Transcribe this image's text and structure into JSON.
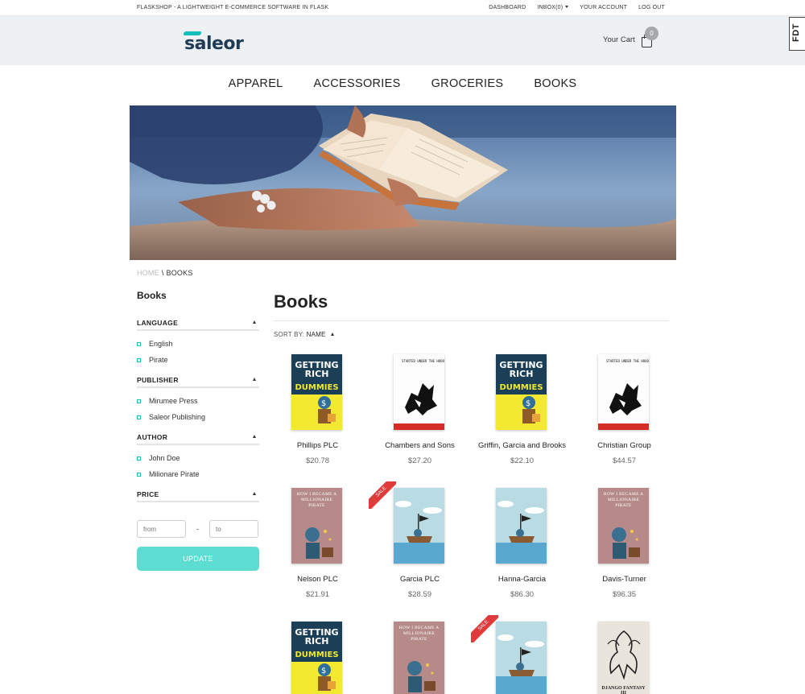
{
  "topbar": {
    "tagline": "FLASKSHOP - A LIGHTWEIGHT E-COMMERCE SOFTWARE IN FLASK",
    "links": [
      "DASHBOARD",
      "INBOX(0)",
      "YOUR ACCOUNT",
      "LOG OUT"
    ]
  },
  "header": {
    "logo": "saleor",
    "cart_label": "Your Cart",
    "cart_count": "0",
    "fdt_tab": "FDT"
  },
  "nav": [
    "APPAREL",
    "ACCESSORIES",
    "GROCERIES",
    "BOOKS"
  ],
  "breadcrumb": {
    "home": "HOME",
    "separator": "\\",
    "current": "BOOKS"
  },
  "sidebar": {
    "title": "Books",
    "filters": [
      {
        "title": "LANGUAGE",
        "options": [
          "English",
          "Pirate"
        ]
      },
      {
        "title": "PUBLISHER",
        "options": [
          "Mirumee Press",
          "Saleor Publishing"
        ]
      },
      {
        "title": "AUTHOR",
        "options": [
          "John Doe",
          "Milionare Pirate"
        ]
      }
    ],
    "price": {
      "title": "PRICE",
      "from_placeholder": "from",
      "to_placeholder": "to",
      "dash": "-",
      "update_label": "UPDATE"
    }
  },
  "main": {
    "title": "Books",
    "sort_prefix": "SORT BY:",
    "sort_value": "NAME"
  },
  "products": [
    {
      "name": "Phillips PLC",
      "price": "$20.78",
      "cover": "dummies",
      "sale": false
    },
    {
      "name": "Chambers and Sons",
      "price": "$27.20",
      "cover": "under",
      "sale": false
    },
    {
      "name": "Griffin, Garcia and Brooks",
      "price": "$22.10",
      "cover": "dummies",
      "sale": false
    },
    {
      "name": "Christian Group",
      "price": "$44.57",
      "cover": "under",
      "sale": false
    },
    {
      "name": "Nelson PLC",
      "price": "$21.91",
      "cover": "millionaire",
      "sale": false
    },
    {
      "name": "Garcia PLC",
      "price": "$28.59",
      "cover": "pirate-ship",
      "sale": true
    },
    {
      "name": "Hanna-Garcia",
      "price": "$86.30",
      "cover": "pirate-ship",
      "sale": false
    },
    {
      "name": "Davis-Turner",
      "price": "$96.35",
      "cover": "millionaire",
      "sale": false
    },
    {
      "name": "",
      "price": "",
      "cover": "dummies",
      "sale": false
    },
    {
      "name": "",
      "price": "",
      "cover": "millionaire",
      "sale": false
    },
    {
      "name": "",
      "price": "",
      "cover": "pirate-ship",
      "sale": true
    },
    {
      "name": "",
      "price": "",
      "cover": "fantasy",
      "sale": false
    }
  ],
  "cover_text": {
    "dummies_title": "GETTING RICH",
    "dummies_sub": "DUMMIES",
    "under": "STARTED UNDER THE HOOD",
    "millionaire": "HOW I BECAME A MILLIONAIRE PIRATE",
    "fantasy": "DJANGO FANTASY III"
  },
  "sale_label": "SALE",
  "colors": {
    "accent": "#13bebb",
    "button": "#5ddcd2",
    "header_bg": "#eef1f3",
    "sale": "#e03b3b"
  }
}
